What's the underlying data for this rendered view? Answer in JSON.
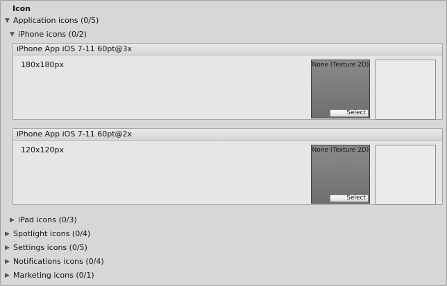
{
  "title": "Icon",
  "application_icons": {
    "label": "Application icons (0/5)",
    "expanded": true
  },
  "iphone_icons": {
    "label": "iPhone icons (0/2)",
    "expanded": true,
    "entries": [
      {
        "header": "iPhone App iOS 7-11 60pt@3x",
        "size": "180x180px",
        "texture_value": "None (Texture 2D)",
        "select_label": "Select"
      },
      {
        "header": "iPhone App iOS 7-11 60pt@2x",
        "size": "120x120px",
        "texture_value": "None (Texture 2D)",
        "select_label": "Select"
      }
    ]
  },
  "collapsed_groups": [
    {
      "label": "iPad icons (0/3)"
    },
    {
      "label": "Spotlight icons (0/4)"
    },
    {
      "label": "Settings icons (0/5)"
    },
    {
      "label": "Notifications icons (0/4)"
    },
    {
      "label": "Marketing icons (0/1)"
    }
  ],
  "icons": {
    "expanded": "triangle-down-icon",
    "collapsed": "triangle-right-icon"
  }
}
